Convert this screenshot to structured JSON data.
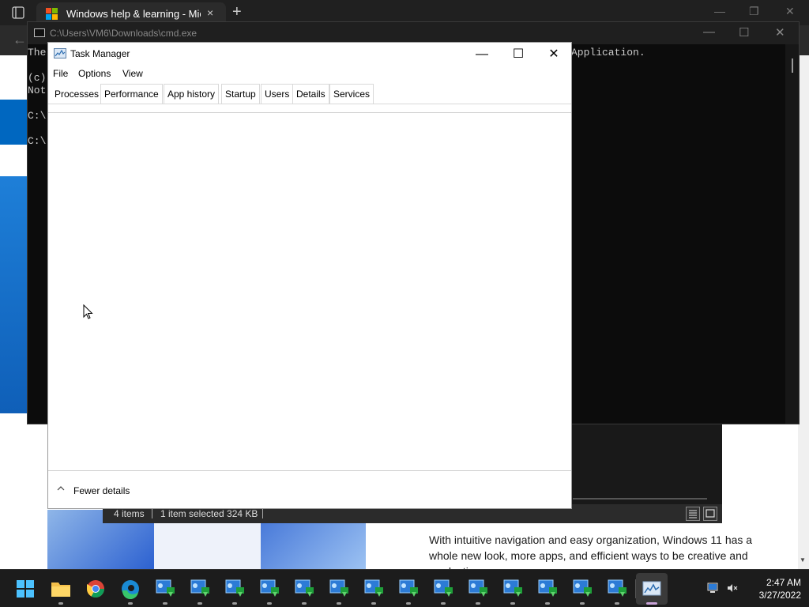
{
  "browser": {
    "tab_title": "Windows help & learning - Micr",
    "tab_close": "×",
    "new_tab": "+",
    "back": "←",
    "page_text": "With intuitive navigation and easy organization, Windows 11 has a whole new look, more apps, and efficient ways to be creative and productive."
  },
  "cmd": {
    "title": "C:\\Users\\VM6\\Downloads\\cmd.exe",
    "lines": [
      "The",
      "(c)",
      "Not",
      "C:\\",
      "C:\\"
    ],
    "line_right": "Application."
  },
  "explorer": {
    "status_items": "4 items",
    "status_selected": "1 item selected  324 KB"
  },
  "task_manager": {
    "title": "Task Manager",
    "menu": [
      "File",
      "Options",
      "View"
    ],
    "tabs": [
      "Processes",
      "Performance",
      "App history",
      "Startup",
      "Users",
      "Details",
      "Services"
    ],
    "active_tab": "Processes",
    "fewer_details": "Fewer details",
    "controls": {
      "minimize": "—",
      "maximize": "☐",
      "close": "✕"
    }
  },
  "taskbar": {
    "apps": [
      "windows-start-icon",
      "file-explorer-icon",
      "chrome-icon",
      "edge-icon",
      "installer-icon",
      "installer-icon",
      "installer-icon",
      "installer-icon",
      "installer-icon",
      "installer-icon",
      "installer-icon",
      "installer-icon",
      "installer-icon",
      "installer-icon",
      "installer-icon",
      "installer-icon",
      "installer-icon",
      "installer-icon",
      "task-manager-icon"
    ],
    "time": "2:47 AM",
    "date": "3/27/2022"
  },
  "colors": {
    "accent": "#0067c0",
    "taskbar": "#1c1c1c",
    "cmd_bg": "#0c0c0c"
  }
}
